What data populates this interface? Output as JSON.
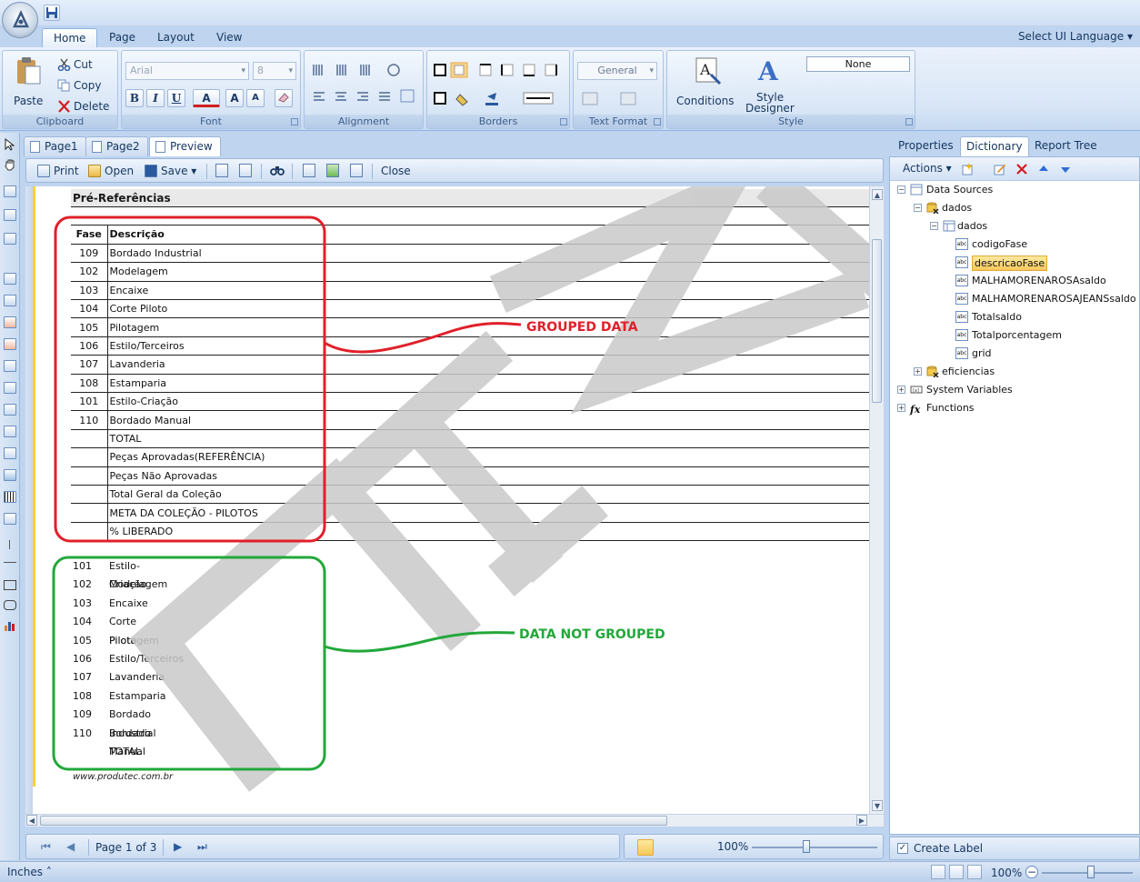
{
  "qat": {
    "save_icon": "save-icon"
  },
  "ribbon_tabs": [
    "Home",
    "Page",
    "Layout",
    "View"
  ],
  "ui_language_label": "Select UI Language",
  "clipboard": {
    "paste": "Paste",
    "cut": "Cut",
    "copy": "Copy",
    "delete": "Delete",
    "group_label": "Clipboard"
  },
  "font": {
    "family": "Arial",
    "size": "8",
    "bold": "B",
    "italic": "I",
    "underline": "U",
    "color": "A",
    "grow": "A",
    "shrink": "A",
    "group_label": "Font"
  },
  "alignment": {
    "group_label": "Alignment"
  },
  "borders": {
    "group_label": "Borders"
  },
  "text_format": {
    "format_value": "General",
    "group_label": "Text Format"
  },
  "style": {
    "conditions": "Conditions",
    "style_designer_line1": "Style",
    "style_designer_line2": "Designer",
    "style_value": "None",
    "group_label": "Style"
  },
  "doc_tabs": [
    "Page1",
    "Page2",
    "Preview"
  ],
  "preview_toolbar": {
    "print": "Print",
    "open": "Open",
    "save": "Save",
    "close": "Close"
  },
  "report": {
    "title": "Pré-Referências",
    "grouped_header": {
      "fase": "Fase",
      "descricao": "Descrição"
    },
    "grouped_rows": [
      {
        "fase": "109",
        "descricao": "Bordado Industrial"
      },
      {
        "fase": "102",
        "descricao": "Modelagem"
      },
      {
        "fase": "103",
        "descricao": "Encaixe"
      },
      {
        "fase": "104",
        "descricao": "Corte Piloto"
      },
      {
        "fase": "105",
        "descricao": "Pilotagem"
      },
      {
        "fase": "106",
        "descricao": "Estilo/Terceiros"
      },
      {
        "fase": "107",
        "descricao": "Lavanderia"
      },
      {
        "fase": "108",
        "descricao": "Estamparia"
      },
      {
        "fase": "101",
        "descricao": "Estilo-Criação"
      },
      {
        "fase": "110",
        "descricao": "Bordado Manual"
      },
      {
        "fase": "",
        "descricao": "TOTAL"
      },
      {
        "fase": "",
        "descricao": "Peças Aprovadas(REFERÊNCIA)"
      },
      {
        "fase": "",
        "descricao": "Peças Não Aprovadas"
      },
      {
        "fase": "",
        "descricao": "Total Geral da Coleção"
      },
      {
        "fase": "",
        "descricao": "META DA COLEÇÃO - PILOTOS"
      },
      {
        "fase": "",
        "descricao": "% LIBERADO"
      }
    ],
    "ungrouped_rows": [
      {
        "fase": "101",
        "descricao": "Estilo-Criação"
      },
      {
        "fase": "102",
        "descricao": "Modelagem"
      },
      {
        "fase": "103",
        "descricao": "Encaixe"
      },
      {
        "fase": "104",
        "descricao": "Corte Piloto"
      },
      {
        "fase": "105",
        "descricao": "Pilotagem"
      },
      {
        "fase": "106",
        "descricao": "Estilo/Terceiros"
      },
      {
        "fase": "107",
        "descricao": "Lavanderia"
      },
      {
        "fase": "108",
        "descricao": "Estamparia"
      },
      {
        "fase": "109",
        "descricao": "Bordado Industrial"
      },
      {
        "fase": "110",
        "descricao": "Bordado Manual"
      },
      {
        "fase": "",
        "descricao": "TOTAL"
      }
    ],
    "footer_url": "www.produtec.com.br"
  },
  "annotations": {
    "grouped_label": "GROUPED DATA",
    "grouped_color": "#e0202a",
    "ungrouped_label": "DATA NOT GROUPED",
    "ungrouped_color": "#22a83a"
  },
  "watermark_color": "#c9c9c9",
  "navigation": {
    "page_indicator": "Page 1 of 3",
    "zoom": "100%"
  },
  "right_panel": {
    "tabs": [
      "Properties",
      "Dictionary",
      "Report Tree"
    ],
    "actions_label": "Actions",
    "tree": {
      "data_sources": "Data Sources",
      "dados_source": "dados",
      "dados_table": "dados",
      "fields": [
        "codigoFase",
        "descricaoFase",
        "MALHAMORENAROSAsaldo",
        "MALHAMORENAROSAJEANSsaldo",
        "Totalsaldo",
        "Totalporcentagem",
        "grid"
      ],
      "selected_field": "descricaoFase",
      "eficiencias": "eficiencias",
      "system_variables": "System Variables",
      "functions": "Functions"
    },
    "create_label": "Create Label"
  },
  "status_bar": {
    "units": "Inches",
    "zoom": "100%"
  }
}
